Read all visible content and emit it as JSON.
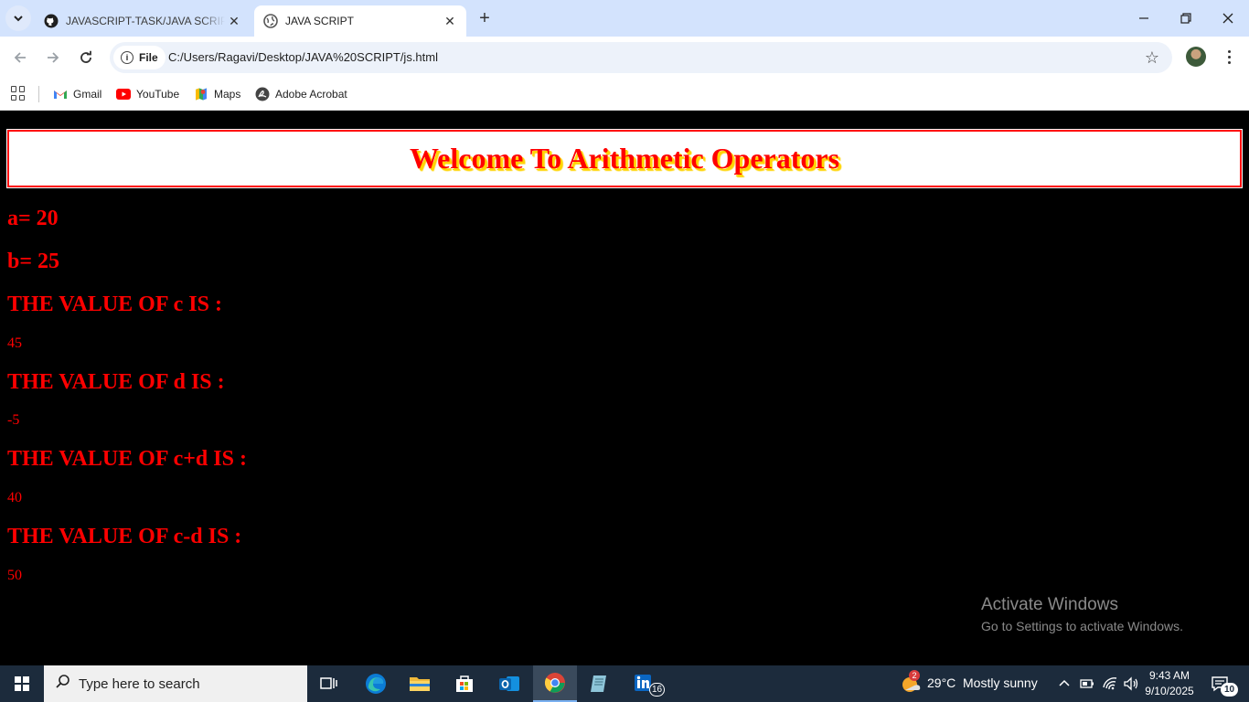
{
  "browser": {
    "tabs": [
      {
        "title": "JAVASCRIPT-TASK/JAVA SCRIPT",
        "active": false,
        "icon": "github-icon"
      },
      {
        "title": "JAVA SCRIPT",
        "active": true,
        "icon": "globe-icon"
      }
    ],
    "address": {
      "scheme_label": "File",
      "url": "C:/Users/Ragavi/Desktop/JAVA%20SCRIPT/js.html"
    },
    "bookmarks": [
      {
        "label": "Gmail",
        "icon": "gmail-icon"
      },
      {
        "label": "YouTube",
        "icon": "youtube-icon"
      },
      {
        "label": "Maps",
        "icon": "maps-icon"
      },
      {
        "label": "Adobe Acrobat",
        "icon": "acrobat-icon"
      }
    ]
  },
  "page": {
    "heading": "Welcome To Arithmetic Operators",
    "line_a": "a= 20",
    "line_b": "b= 25",
    "label_c": "THE VALUE OF c IS :",
    "value_c": "45",
    "label_d": "THE VALUE OF d IS :",
    "value_d": "-5",
    "label_cpd": "THE VALUE OF c+d IS :",
    "value_cpd": "40",
    "label_cmd": "THE VALUE OF c-d IS :",
    "value_cmd": "50",
    "text_color": "#ff0000",
    "shadow_color": "#ffd400"
  },
  "watermark": {
    "line1": "Activate Windows",
    "line2": "Go to Settings to activate Windows."
  },
  "taskbar": {
    "search_placeholder": "Type here to search",
    "weather_badge": "2",
    "weather_temp": "29°C",
    "weather_desc": "Mostly sunny",
    "linkedin_badge": "16",
    "time": "9:43 AM",
    "date": "9/10/2025",
    "notifications": "10"
  }
}
